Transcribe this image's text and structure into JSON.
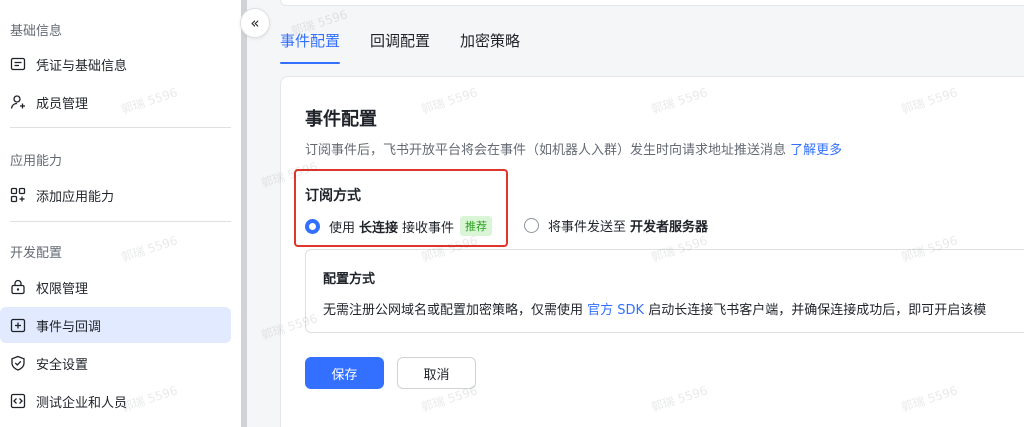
{
  "sidebar": {
    "groups": [
      {
        "label": "基础信息",
        "items": [
          {
            "label": "凭证与基础信息",
            "icon": "id-card-icon"
          },
          {
            "label": "成员管理",
            "icon": "user-add-icon"
          }
        ]
      },
      {
        "label": "应用能力",
        "items": [
          {
            "label": "添加应用能力",
            "icon": "grid-add-icon"
          }
        ]
      },
      {
        "label": "开发配置",
        "items": [
          {
            "label": "权限管理",
            "icon": "lock-icon"
          },
          {
            "label": "事件与回调",
            "icon": "event-icon",
            "active": true
          },
          {
            "label": "安全设置",
            "icon": "shield-icon"
          },
          {
            "label": "测试企业和人员",
            "icon": "code-icon"
          }
        ]
      }
    ]
  },
  "collapse": {
    "glyph": "«"
  },
  "tabs": [
    {
      "label": "事件配置",
      "active": true
    },
    {
      "label": "回调配置"
    },
    {
      "label": "加密策略"
    }
  ],
  "main": {
    "title": "事件配置",
    "desc": "订阅事件后，飞书开放平台将会在事件（如机器人入群）发生时向请求地址推送消息",
    "desc_link": "了解更多",
    "sub_title": "订阅方式",
    "option1": {
      "pre": "使用",
      "strong": "长连接",
      "post": "接收事件",
      "badge": "推荐",
      "checked": true
    },
    "option2": {
      "pre": "将事件发送至",
      "strong": "开发者服务器",
      "checked": false
    },
    "config": {
      "title": "配置方式",
      "desc_pre": "无需注册公网域名或配置加密策略，仅需使用",
      "desc_link": "官方 SDK",
      "desc_post": "启动长连接飞书客户端，并确保连接成功后，即可开启该模"
    },
    "save_label": "保存",
    "cancel_label": "取消"
  },
  "watermark": "郭瑞 5596",
  "colors": {
    "accent": "#3370ff",
    "highlight_border": "#e0352b",
    "badge_bg": "#d9f5d6",
    "badge_text": "#2ea121"
  }
}
